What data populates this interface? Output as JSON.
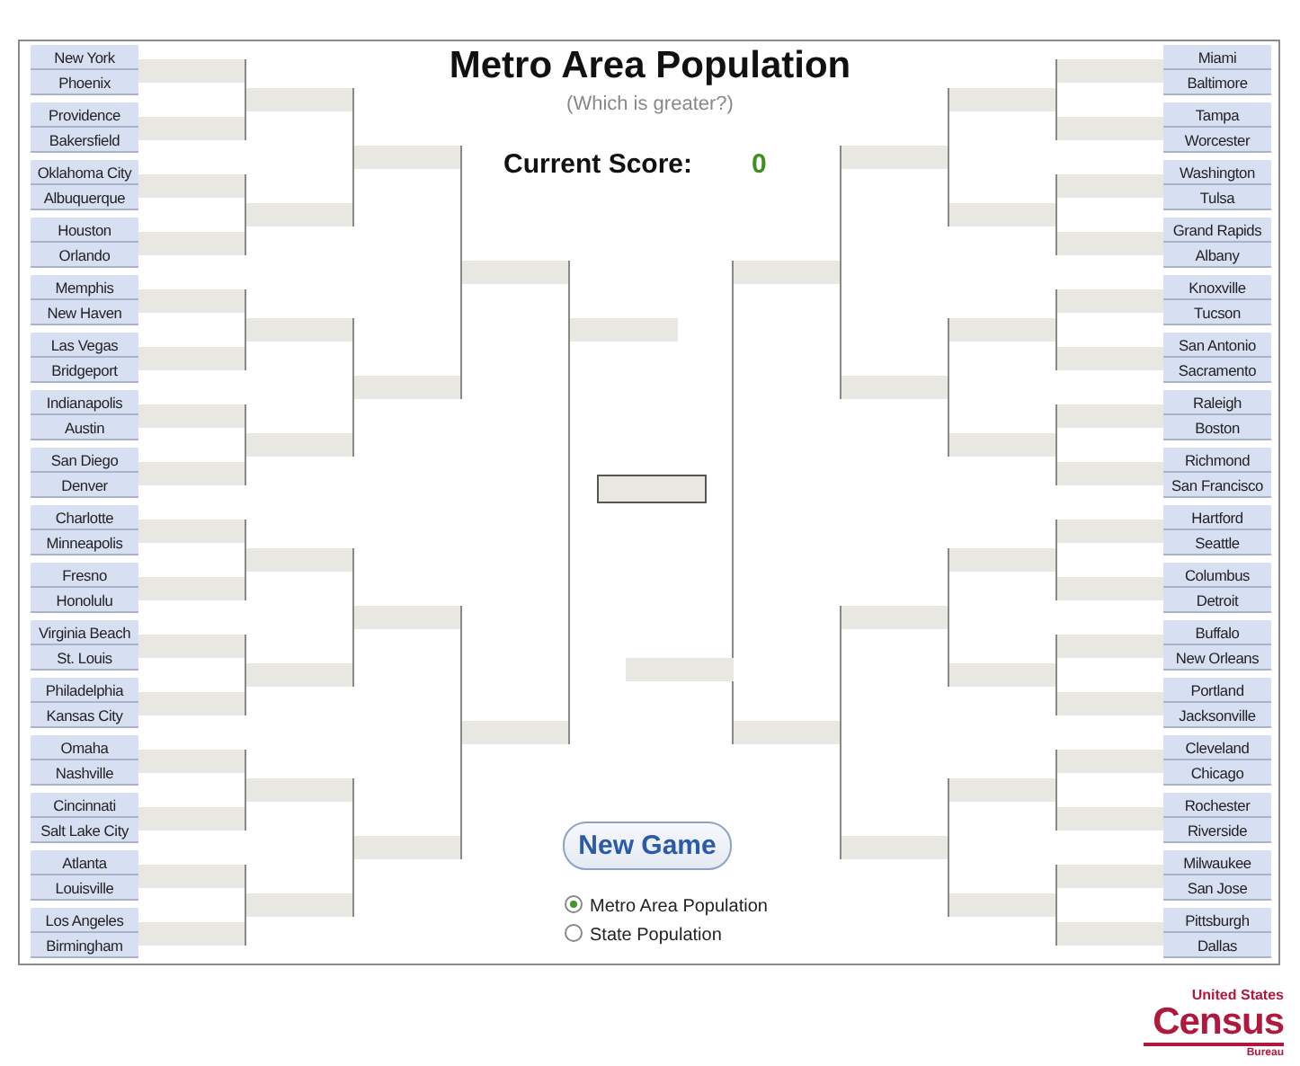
{
  "title": "Metro Area Population",
  "subtitle": "(Which is greater?)",
  "score": {
    "label": "Current Score:",
    "value": "0"
  },
  "left_matchups": [
    [
      "New York",
      "Phoenix"
    ],
    [
      "Providence",
      "Bakersfield"
    ],
    [
      "Oklahoma City",
      "Albuquerque"
    ],
    [
      "Houston",
      "Orlando"
    ],
    [
      "Memphis",
      "New Haven"
    ],
    [
      "Las Vegas",
      "Bridgeport"
    ],
    [
      "Indianapolis",
      "Austin"
    ],
    [
      "San Diego",
      "Denver"
    ],
    [
      "Charlotte",
      "Minneapolis"
    ],
    [
      "Fresno",
      "Honolulu"
    ],
    [
      "Virginia Beach",
      "St. Louis"
    ],
    [
      "Philadelphia",
      "Kansas City"
    ],
    [
      "Omaha",
      "Nashville"
    ],
    [
      "Cincinnati",
      "Salt Lake City"
    ],
    [
      "Atlanta",
      "Louisville"
    ],
    [
      "Los Angeles",
      "Birmingham"
    ]
  ],
  "right_matchups": [
    [
      "Miami",
      "Baltimore"
    ],
    [
      "Tampa",
      "Worcester"
    ],
    [
      "Washington",
      "Tulsa"
    ],
    [
      "Grand Rapids",
      "Albany"
    ],
    [
      "Knoxville",
      "Tucson"
    ],
    [
      "San Antonio",
      "Sacramento"
    ],
    [
      "Raleigh",
      "Boston"
    ],
    [
      "Richmond",
      "San Francisco"
    ],
    [
      "Hartford",
      "Seattle"
    ],
    [
      "Columbus",
      "Detroit"
    ],
    [
      "Buffalo",
      "New Orleans"
    ],
    [
      "Portland",
      "Jacksonville"
    ],
    [
      "Cleveland",
      "Chicago"
    ],
    [
      "Rochester",
      "Riverside"
    ],
    [
      "Milwaukee",
      "San Jose"
    ],
    [
      "Pittsburgh",
      "Dallas"
    ]
  ],
  "new_game_button": "New Game",
  "modes": [
    {
      "label": "Metro Area Population",
      "selected": true
    },
    {
      "label": "State Population",
      "selected": false
    }
  ],
  "logo": {
    "top": "United States",
    "main": "Census",
    "bottom": "Bureau"
  }
}
